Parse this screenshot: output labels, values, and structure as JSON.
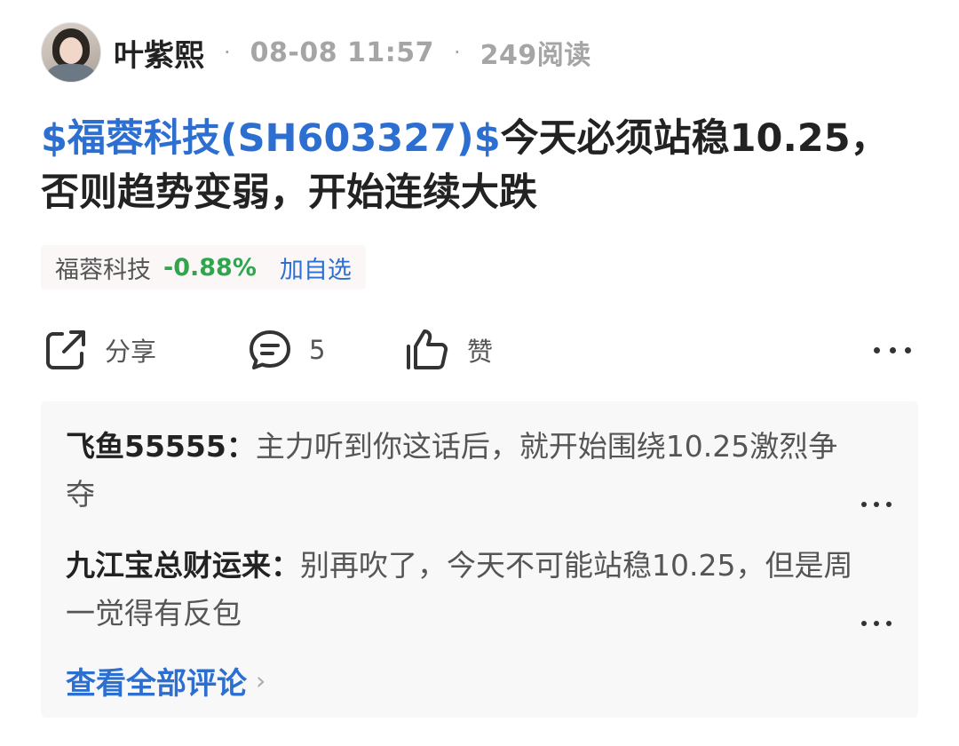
{
  "author": {
    "name": "叶紫熙",
    "date": "08-08 11:57",
    "reads": "249阅读",
    "separator": "·"
  },
  "post": {
    "stock_tag": "$福蓉科技(SH603327)$",
    "text": "今天必须站稳10.25，否则趋势变弱，开始连续大跌"
  },
  "stock_chip": {
    "name": "福蓉科技",
    "change": "-0.88%",
    "add_label": "加自选",
    "change_color": "#2fa64e"
  },
  "actions": {
    "share_label": "分享",
    "comment_count": "5",
    "like_label": "赞"
  },
  "comments": [
    {
      "author": "飞鱼55555",
      "text": "主力听到你这话后，就开始围绕10.25激烈争夺"
    },
    {
      "author": "九江宝总财运来",
      "text": "别再吹了，今天不可能站稳10.25，但是周一觉得有反包"
    }
  ],
  "view_all": {
    "label": "查看全部评论",
    "chevron": "›"
  },
  "colors": {
    "link": "#2d6fd1",
    "muted": "#a5a5a5",
    "panel": "#f8f8f9"
  }
}
